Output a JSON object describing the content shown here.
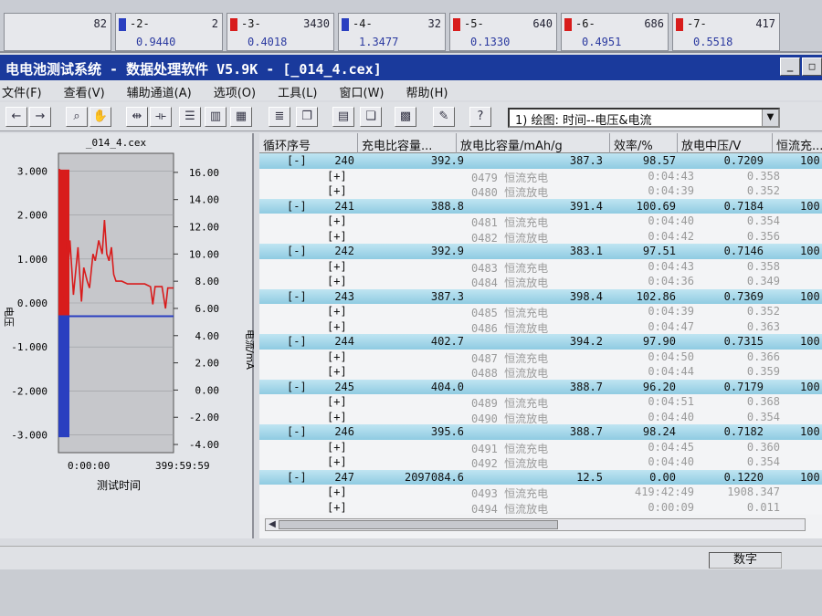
{
  "channels": [
    {
      "num": "",
      "count": "82",
      "val": "",
      "flag": "none"
    },
    {
      "num": "-2-",
      "count": "2",
      "val": "0.9440",
      "flag": "blue"
    },
    {
      "num": "-3-",
      "count": "3430",
      "val": "0.4018",
      "flag": "red"
    },
    {
      "num": "-4-",
      "count": "32",
      "val": "1.3477",
      "flag": "blue"
    },
    {
      "num": "-5-",
      "count": "640",
      "val": "0.1330",
      "flag": "red"
    },
    {
      "num": "-6-",
      "count": "686",
      "val": "0.4951",
      "flag": "red"
    },
    {
      "num": "-7-",
      "count": "417",
      "val": "0.5518",
      "flag": "red"
    }
  ],
  "window": {
    "title": "电电池测试系统 - 数据处理软件 V5.9K - [_014_4.cex]"
  },
  "menu": [
    "文件(F)",
    "查看(V)",
    "辅助通道(A)",
    "选项(O)",
    "工具(L)",
    "窗口(W)",
    "帮助(H)"
  ],
  "toolbar": {
    "plot_select": "1) 绘图: 时间--电压&电流"
  },
  "chart": {
    "title": "_014_4.cex",
    "xlabel": "测试时间",
    "right_axis_label": "电流/mA",
    "left_axis_label": "电压"
  },
  "chart_data": {
    "type": "line",
    "title": "_014_4.cex",
    "xlabel": "测试时间",
    "x_ticks": [
      "0:00:00",
      "399:59:59"
    ],
    "left_ticks": [
      "3.000",
      "2.000",
      "1.000",
      "0.000",
      "-1.000",
      "-2.000",
      "-3.000"
    ],
    "right_ticks": [
      "16.00",
      "14.00",
      "12.00",
      "10.00",
      "8.00",
      "6.00",
      "4.00",
      "2.00",
      "0.00",
      "-2.00",
      "-4.00"
    ],
    "ylabel_right": "电流/mA",
    "ylim_left": [
      -3.4,
      3.4
    ],
    "ylim_right": [
      -4.6,
      17.4
    ],
    "series": [
      {
        "name": "电流",
        "color": "#d81c1c",
        "points": [
          [
            0.0,
            16.2
          ],
          [
            0.01,
            16.2
          ],
          [
            0.03,
            7.0
          ],
          [
            0.05,
            6.5
          ],
          [
            0.07,
            16.0
          ],
          [
            0.08,
            8.5
          ],
          [
            0.1,
            11.0
          ],
          [
            0.13,
            7.0
          ],
          [
            0.17,
            10.5
          ],
          [
            0.2,
            6.5
          ],
          [
            0.22,
            9.0
          ],
          [
            0.25,
            8.0
          ],
          [
            0.27,
            7.5
          ],
          [
            0.3,
            10.0
          ],
          [
            0.32,
            9.5
          ],
          [
            0.35,
            11.0
          ],
          [
            0.38,
            10.0
          ],
          [
            0.4,
            12.5
          ],
          [
            0.42,
            10.0
          ],
          [
            0.44,
            9.5
          ],
          [
            0.46,
            10.5
          ],
          [
            0.48,
            8.5
          ],
          [
            0.5,
            8.0
          ],
          [
            0.55,
            8.0
          ],
          [
            0.6,
            7.8
          ],
          [
            0.65,
            7.8
          ],
          [
            0.7,
            7.8
          ],
          [
            0.75,
            7.8
          ],
          [
            0.8,
            7.6
          ],
          [
            0.82,
            6.3
          ],
          [
            0.84,
            7.6
          ],
          [
            0.9,
            7.6
          ],
          [
            0.93,
            6.0
          ],
          [
            0.95,
            7.5
          ],
          [
            0.98,
            7.5
          ],
          [
            1.0,
            7.5
          ]
        ]
      },
      {
        "name": "电压",
        "color": "#2a3fc0",
        "points": [
          [
            0.0,
            -0.3
          ],
          [
            0.05,
            -0.3
          ],
          [
            0.07,
            -0.3
          ],
          [
            1.0,
            -0.3
          ]
        ]
      }
    ]
  },
  "grid": {
    "headers": [
      "循环序号",
      "充电比容量...",
      "放电比容量/mAh/g",
      "效率/%",
      "放电中压/V",
      "恒流充..."
    ],
    "cycles": [
      {
        "tag": "[-]",
        "cycle": "240",
        "charge": "392.9",
        "discharge": "387.3",
        "eff": "98.57",
        "vmid": "0.7209",
        "tail": "100",
        "subs": [
          {
            "tag": "[+]",
            "name": "0479 恒流充电",
            "time": "0:04:43",
            "v": "0.358"
          },
          {
            "tag": "[+]",
            "name": "0480 恒流放电",
            "time": "0:04:39",
            "v": "0.352"
          }
        ]
      },
      {
        "tag": "[-]",
        "cycle": "241",
        "charge": "388.8",
        "discharge": "391.4",
        "eff": "100.69",
        "vmid": "0.7184",
        "tail": "100",
        "subs": [
          {
            "tag": "[+]",
            "name": "0481 恒流充电",
            "time": "0:04:40",
            "v": "0.354"
          },
          {
            "tag": "[+]",
            "name": "0482 恒流放电",
            "time": "0:04:42",
            "v": "0.356"
          }
        ]
      },
      {
        "tag": "[-]",
        "cycle": "242",
        "charge": "392.9",
        "discharge": "383.1",
        "eff": "97.51",
        "vmid": "0.7146",
        "tail": "100",
        "subs": [
          {
            "tag": "[+]",
            "name": "0483 恒流充电",
            "time": "0:04:43",
            "v": "0.358"
          },
          {
            "tag": "[+]",
            "name": "0484 恒流放电",
            "time": "0:04:36",
            "v": "0.349"
          }
        ]
      },
      {
        "tag": "[-]",
        "cycle": "243",
        "charge": "387.3",
        "discharge": "398.4",
        "eff": "102.86",
        "vmid": "0.7369",
        "tail": "100.",
        "subs": [
          {
            "tag": "[+]",
            "name": "0485 恒流充电",
            "time": "0:04:39",
            "v": "0.352"
          },
          {
            "tag": "[+]",
            "name": "0486 恒流放电",
            "time": "0:04:47",
            "v": "0.363"
          }
        ]
      },
      {
        "tag": "[-]",
        "cycle": "244",
        "charge": "402.7",
        "discharge": "394.2",
        "eff": "97.90",
        "vmid": "0.7315",
        "tail": "100.",
        "subs": [
          {
            "tag": "[+]",
            "name": "0487 恒流充电",
            "time": "0:04:50",
            "v": "0.366"
          },
          {
            "tag": "[+]",
            "name": "0488 恒流放电",
            "time": "0:04:44",
            "v": "0.359"
          }
        ]
      },
      {
        "tag": "[-]",
        "cycle": "245",
        "charge": "404.0",
        "discharge": "388.7",
        "eff": "96.20",
        "vmid": "0.7179",
        "tail": "100.",
        "subs": [
          {
            "tag": "[+]",
            "name": "0489 恒流充电",
            "time": "0:04:51",
            "v": "0.368"
          },
          {
            "tag": "[+]",
            "name": "0490 恒流放电",
            "time": "0:04:40",
            "v": "0.354"
          }
        ]
      },
      {
        "tag": "[-]",
        "cycle": "246",
        "charge": "395.6",
        "discharge": "388.7",
        "eff": "98.24",
        "vmid": "0.7182",
        "tail": "100.",
        "subs": [
          {
            "tag": "[+]",
            "name": "0491 恒流充电",
            "time": "0:04:45",
            "v": "0.360"
          },
          {
            "tag": "[+]",
            "name": "0492 恒流放电",
            "time": "0:04:40",
            "v": "0.354"
          }
        ]
      },
      {
        "tag": "[-]",
        "cycle": "247",
        "charge": "2097084.6",
        "discharge": "12.5",
        "eff": "0.00",
        "vmid": "0.1220",
        "tail": "100.",
        "subs": [
          {
            "tag": "[+]",
            "name": "0493 恒流充电",
            "time": "419:42:49",
            "v": "1908.347"
          },
          {
            "tag": "[+]",
            "name": "0494 恒流放电",
            "time": "0:00:09",
            "v": "0.011"
          }
        ]
      }
    ]
  },
  "status": {
    "mode": "数字"
  }
}
